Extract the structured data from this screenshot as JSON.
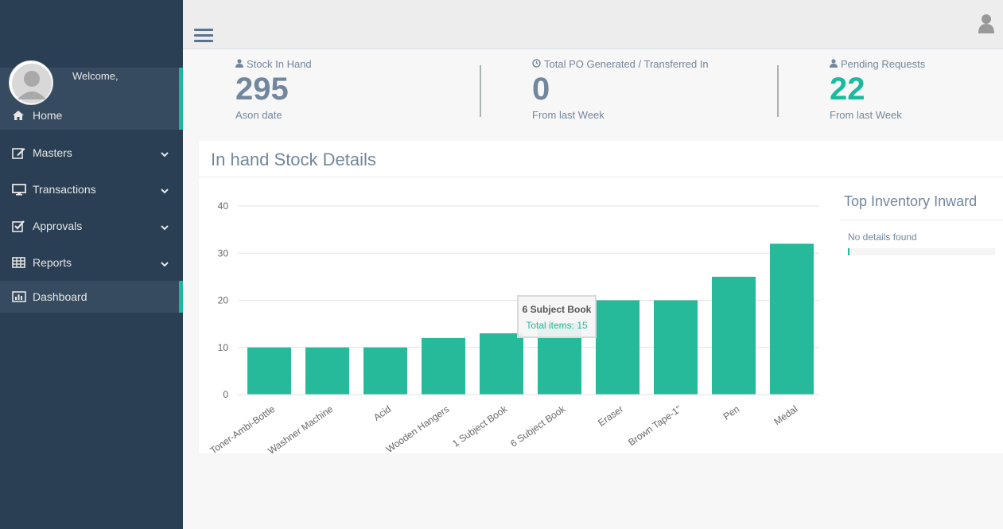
{
  "sidebar": {
    "welcome": "Welcome,",
    "items": [
      {
        "label": "Home",
        "icon": "home-icon"
      },
      {
        "label": "Masters",
        "icon": "edit-icon"
      },
      {
        "label": "Transactions",
        "icon": "desktop-icon"
      },
      {
        "label": "Approvals",
        "icon": "check-square-icon"
      },
      {
        "label": "Reports",
        "icon": "table-icon"
      },
      {
        "label": "Dashboard",
        "icon": "bar-chart-icon"
      }
    ]
  },
  "stats": [
    {
      "label": "Stock In Hand",
      "value": "295",
      "sub": "Ason date",
      "icon": "user-icon"
    },
    {
      "label": "Total PO Generated / Transferred In",
      "value": "0",
      "sub": "From last Week",
      "icon": "clock-icon"
    },
    {
      "label": "Pending Requests",
      "value": "22",
      "sub": "From last Week",
      "icon": "user-icon"
    }
  ],
  "panel": {
    "title": "In hand Stock Details"
  },
  "chart_data": {
    "type": "bar",
    "categories": [
      "Toner-Ambi-Bottle",
      "Washner Machine",
      "Acid",
      "Wooden Hangers",
      "1 Subject Book",
      "6 Subject Book",
      "Eraser",
      "Brown Tape-1\"",
      "Pen",
      "Medal"
    ],
    "values": [
      10,
      10,
      10,
      12,
      13,
      15,
      20,
      20,
      25,
      32
    ],
    "yticks": [
      0,
      10,
      20,
      30,
      40
    ],
    "ylim": [
      0,
      40
    ],
    "grid": true,
    "color": "#26b99a"
  },
  "tooltip": {
    "title": "6 Subject Book",
    "text": "Total items: 15"
  },
  "side": {
    "title": "Top Inventory Inward",
    "text": "No details found",
    "progress": 0.01
  },
  "colors": {
    "sidebar": "#2a3f54",
    "accent": "#1abb9c",
    "bar": "#26b99a"
  }
}
